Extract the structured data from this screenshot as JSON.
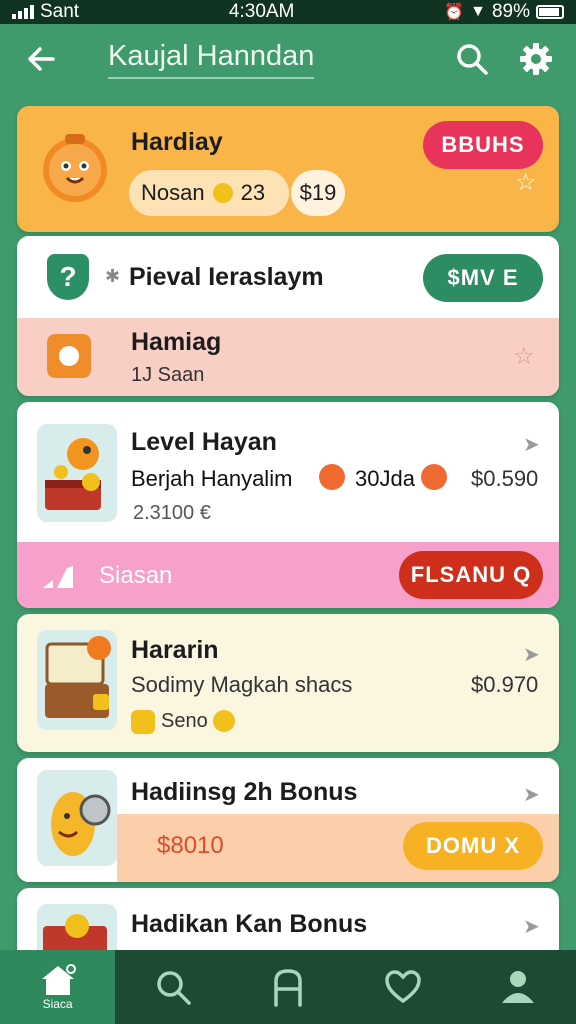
{
  "status_bar": {
    "carrier": "Sant",
    "time": "4:30AM",
    "battery": "89%"
  },
  "app_bar": {
    "title": "Kaujal Hanndan"
  },
  "cards": [
    {
      "title": "Hardiay",
      "chip1_label": "Nosan",
      "chip1_value": "23",
      "chip2_value": "$19",
      "button": "BBUHS"
    },
    {
      "title": "Pieval Ieraslaym",
      "button": "$MV E"
    },
    {
      "title": "Hamiag",
      "subtitle": "1J Saan"
    },
    {
      "title": "Level Hayan",
      "subtitle": "Berjah Hanyalim",
      "meta": "30Jda",
      "price": "$0.590",
      "extra": "2.3100 €",
      "footer_label": "Siasan",
      "button": "FLSANU Q"
    },
    {
      "title": "Hararin",
      "subtitle": "Sodimy Magkah shacs",
      "price": "$0.970",
      "chip_label": "Seno"
    },
    {
      "title": "Hadiinsg 2h Bonus",
      "amount": "$8010",
      "button": "DOMU X"
    },
    {
      "title": "Hadikan Kan Bonus"
    }
  ],
  "bottom_nav": {
    "home_label": "Siaca"
  }
}
